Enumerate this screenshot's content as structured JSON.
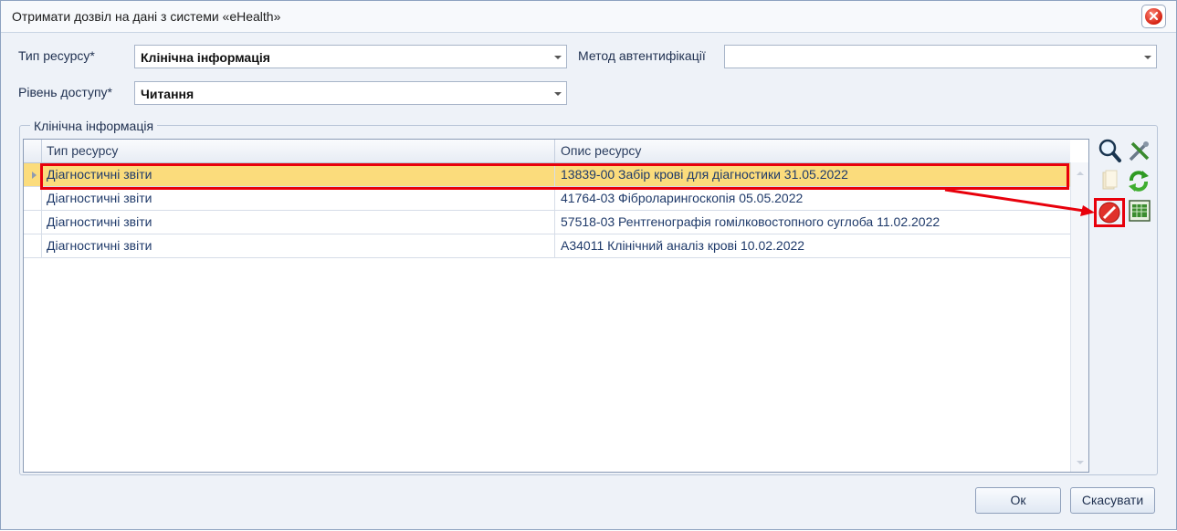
{
  "window": {
    "title": "Отримати дозвіл на дані з системи «eHealth»"
  },
  "form": {
    "resource_type_label": "Тип ресурсу*",
    "resource_type_value": "Клінічна інформація",
    "auth_method_label": "Метод автентифікації",
    "auth_method_value": "",
    "access_level_label": "Рівень доступу*",
    "access_level_value": "Читання"
  },
  "group": {
    "title": "Клінічна інформація"
  },
  "grid": {
    "columns": [
      "Тип ресурсу",
      "Опис ресурсу"
    ],
    "rows": [
      {
        "type": "Діагностичні звіти",
        "description": "13839-00 Забір крові для діагностики 31.05.2022",
        "selected": true
      },
      {
        "type": "Діагностичні звіти",
        "description": "41764-03 Фіброларингоскопія 05.05.2022"
      },
      {
        "type": "Діагностичні звіти",
        "description": "57518-03 Рентгенографія гомілковостопного суглоба 11.02.2022"
      },
      {
        "type": "Діагностичні звіти",
        "description": "А34011 Клінічний аналіз крові 10.02.2022"
      }
    ]
  },
  "toolbar": {
    "icons": [
      "search-icon",
      "tools-icon",
      "document-icon",
      "refresh-icon",
      "delete-icon",
      "export-table-icon"
    ]
  },
  "footer": {
    "ok_label": "Ок",
    "cancel_label": "Скасувати"
  },
  "colors": {
    "selection": "#fbdc7c",
    "annotation": "#e8000b"
  }
}
